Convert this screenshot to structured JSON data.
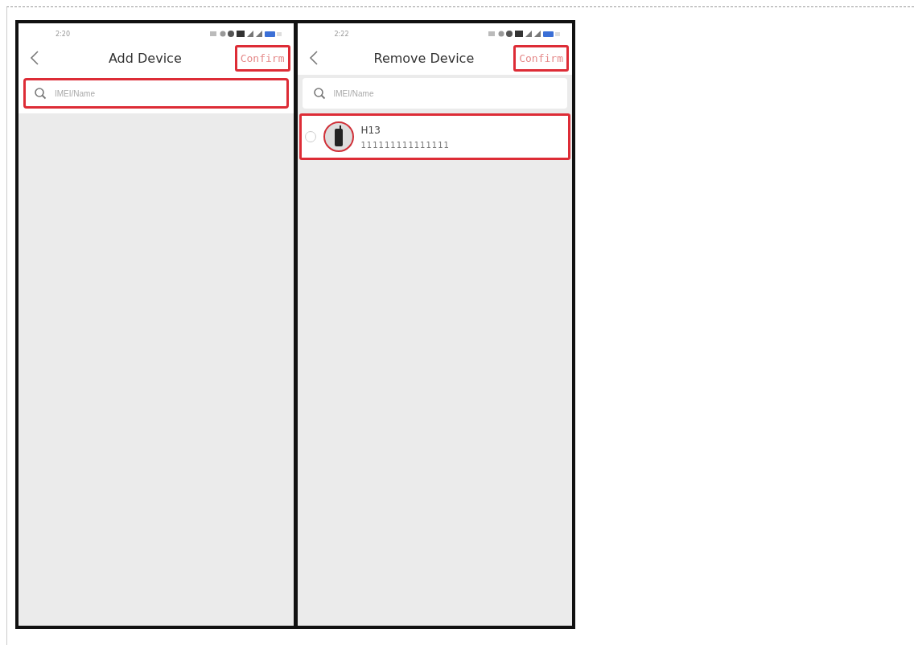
{
  "screens": [
    {
      "time": "2:20",
      "title": "Add Device",
      "confirm": {
        "label": "Confirm",
        "highlighted": true
      },
      "search": {
        "placeholder": "IMEI/Name",
        "highlighted": true
      }
    },
    {
      "time": "2:22",
      "title": "Remove Device",
      "confirm": {
        "label": "Confirm",
        "highlighted": true
      },
      "search": {
        "placeholder": "IMEI/Name",
        "highlighted": false
      },
      "devices": [
        {
          "name": "H13",
          "imei": "111111111111111",
          "selected": false,
          "highlighted": true
        }
      ]
    }
  ]
}
